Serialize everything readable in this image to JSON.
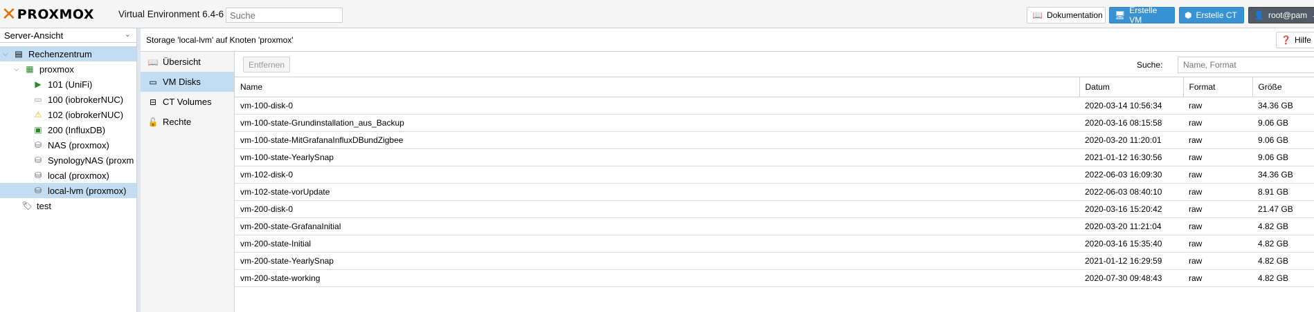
{
  "header": {
    "logo_text": "PROXMOX",
    "version": "Virtual Environment 6.4-6",
    "search_placeholder": "Suche",
    "btn_doc": "Dokumentation",
    "btn_create_vm": "Erstelle VM",
    "btn_create_ct": "Erstelle CT",
    "user": "root@pam"
  },
  "tree": {
    "view": "Server-Ansicht",
    "nodes": [
      {
        "label": "Rechenzentrum"
      },
      {
        "label": "proxmox"
      },
      {
        "label": "101 (UniFi)"
      },
      {
        "label": "100 (iobrokerNUC)"
      },
      {
        "label": "102 (iobrokerNUC)"
      },
      {
        "label": "200 (InfluxDB)"
      },
      {
        "label": "NAS (proxmox)"
      },
      {
        "label": "SynologyNAS (proxm"
      },
      {
        "label": "local (proxmox)"
      },
      {
        "label": "local-lvm (proxmox)"
      },
      {
        "label": "test"
      }
    ]
  },
  "content": {
    "title": "Storage 'local-lvm' auf Knoten 'proxmox'",
    "help": "Hilfe",
    "nav": [
      "Übersicht",
      "VM Disks",
      "CT Volumes",
      "Rechte"
    ],
    "toolbar": {
      "remove": "Entfernen",
      "search_label": "Suche:",
      "filter_placeholder": "Name, Format"
    },
    "columns": [
      "Name",
      "Datum",
      "Format",
      "Größe"
    ],
    "rows": [
      [
        "vm-100-disk-0",
        "2020-03-14 10:56:34",
        "raw",
        "34.36 GB"
      ],
      [
        "vm-100-state-Grundinstallation_aus_Backup",
        "2020-03-16 08:15:58",
        "raw",
        "9.06 GB"
      ],
      [
        "vm-100-state-MitGrafanaInfluxDBundZigbee",
        "2020-03-20 11:20:01",
        "raw",
        "9.06 GB"
      ],
      [
        "vm-100-state-YearlySnap",
        "2021-01-12 16:30:56",
        "raw",
        "9.06 GB"
      ],
      [
        "vm-102-disk-0",
        "2022-06-03 16:09:30",
        "raw",
        "34.36 GB"
      ],
      [
        "vm-102-state-vorUpdate",
        "2022-06-03 08:40:10",
        "raw",
        "8.91 GB"
      ],
      [
        "vm-200-disk-0",
        "2020-03-16 15:20:42",
        "raw",
        "21.47 GB"
      ],
      [
        "vm-200-state-GrafanaInitial",
        "2020-03-20 11:21:04",
        "raw",
        "4.82 GB"
      ],
      [
        "vm-200-state-Initial",
        "2020-03-16 15:35:40",
        "raw",
        "4.82 GB"
      ],
      [
        "vm-200-state-YearlySnap",
        "2021-01-12 16:29:59",
        "raw",
        "4.82 GB"
      ],
      [
        "vm-200-state-working",
        "2020-07-30 09:48:43",
        "raw",
        "4.82 GB"
      ]
    ]
  }
}
